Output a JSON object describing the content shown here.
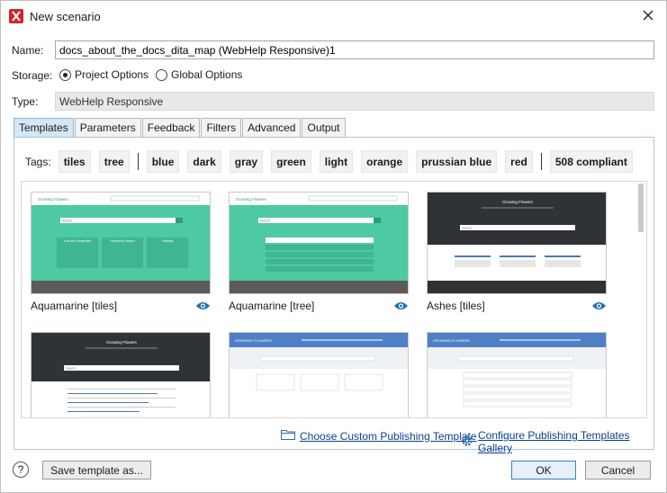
{
  "window": {
    "title": "New scenario",
    "icon": "oxygen-app-icon",
    "close_icon": "close-icon"
  },
  "form": {
    "name_label": "Name:",
    "name_value": "docs_about_the_docs_dita_map (WebHelp Responsive)1",
    "storage_label": "Storage:",
    "storage_options": [
      {
        "label": "Project Options",
        "selected": true
      },
      {
        "label": "Global Options",
        "selected": false
      }
    ],
    "type_label": "Type:",
    "type_value": "WebHelp Responsive"
  },
  "tabs": [
    {
      "label": "Templates",
      "active": true
    },
    {
      "label": "Parameters",
      "active": false
    },
    {
      "label": "Feedback",
      "active": false
    },
    {
      "label": "Filters",
      "active": false
    },
    {
      "label": "Advanced",
      "active": false
    },
    {
      "label": "Output",
      "active": false
    }
  ],
  "tags": {
    "label": "Tags:",
    "group1": [
      "tiles",
      "tree"
    ],
    "group2": [
      "blue",
      "dark",
      "gray",
      "green",
      "light",
      "orange",
      "prussian blue",
      "red"
    ],
    "group3": [
      "508 compliant"
    ]
  },
  "templates": [
    {
      "label": "Aquamarine [tiles]",
      "preview": {
        "brand": "Growing Flowers",
        "search": "Search",
        "cards": [
          "Care and Preparation",
          "Flowers by Season",
          "Glossary"
        ]
      }
    },
    {
      "label": "Aquamarine [tree]",
      "preview": {
        "brand": "Growing Flowers",
        "search": "Search"
      }
    },
    {
      "label": "Ashes [tiles]",
      "preview": {
        "brand": "Growing Flowers",
        "search": "Search"
      }
    },
    {
      "label": "",
      "preview": {
        "brand": "Growing Flowers",
        "search": "Search"
      }
    },
    {
      "label": "",
      "preview": {
        "brand": "GROWING FLOWERS"
      }
    },
    {
      "label": "",
      "preview": {
        "brand": "GROWING FLOWERS"
      }
    }
  ],
  "links": {
    "choose_custom": "Choose Custom Publishing Template",
    "configure_gallery": "Configure Publishing Templates Gallery"
  },
  "buttons": {
    "help": "?",
    "save_template": "Save template as...",
    "ok": "OK",
    "cancel": "Cancel"
  },
  "colors": {
    "aquamarine": "#4dc9a3",
    "ashes_dark": "#2f3337",
    "blue_header": "#4f7fc4",
    "tab_active": "#d4e7f6",
    "link": "#0b3f8c",
    "eye_icon": "#1f6fb3"
  }
}
